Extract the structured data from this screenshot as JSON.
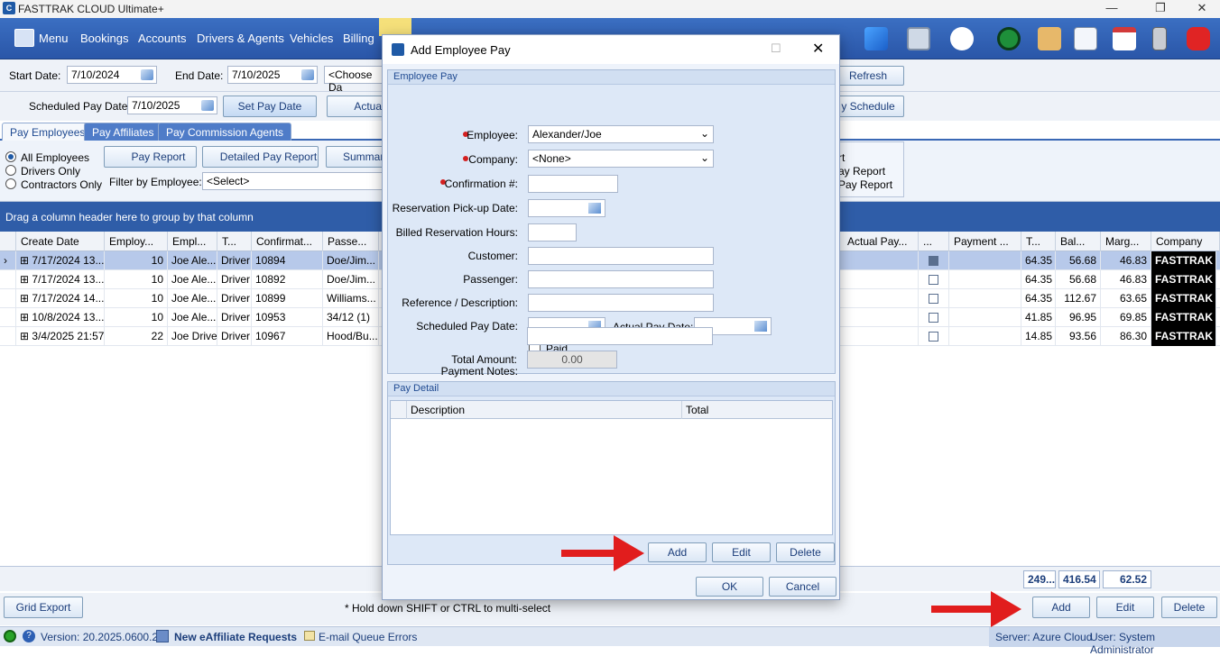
{
  "app": {
    "title": "FASTTRAK CLOUD Ultimate+"
  },
  "menu": {
    "items": [
      "Menu",
      "Bookings",
      "Accounts",
      "Drivers & Agents",
      "Vehicles",
      "Billing"
    ]
  },
  "filters": {
    "start_date_label": "Start Date:",
    "start_date": "7/10/2024",
    "end_date_label": "End Date:",
    "end_date": "7/10/2025",
    "choose_placeholder": "<Choose Da",
    "refresh": "Refresh",
    "scheduled_pay_date_label": "Scheduled Pay Date:",
    "scheduled_pay_date": "7/10/2025",
    "set_pay_date": "Set Pay Date",
    "actual_partial": "Actua",
    "pay_schedule_partial": "y Schedule"
  },
  "tabs": [
    "Pay Employees",
    "Pay Affiliates",
    "Pay Commission Agents"
  ],
  "filterpane": {
    "radios": [
      "All Employees",
      "Drivers Only",
      "Contractors Only"
    ],
    "pay_report": "Pay Report",
    "detailed_pay_report": "Detailed Pay Report",
    "summary_partial": "Summar",
    "filter_by_employee_label": "Filter by Employee:",
    "filter_by_employee_value": "<Select>",
    "right_items": [
      "rt",
      "ay Report",
      "Pay Report"
    ]
  },
  "grid": {
    "group_hint": "Drag a column header here to group by that column",
    "headers_left": [
      "Create Date",
      "Employ...",
      "Empl...",
      "T...",
      "Confirmat...",
      "Passe..."
    ],
    "headers_right": [
      "Actual Pay...",
      "...",
      "Payment ...",
      "T...",
      "Bal...",
      "Marg...",
      "Company"
    ],
    "rows": [
      {
        "create": "7/17/2024 13...",
        "emp": "10",
        "name": "Joe Ale...",
        "type": "Driver",
        "conf": "10894",
        "pass": "Doe/Jim...",
        "t": "64.35",
        "bal": "56.68",
        "marg": "46.83",
        "co": "FASTTRAK ..."
      },
      {
        "create": "7/17/2024 13...",
        "emp": "10",
        "name": "Joe Ale...",
        "type": "Driver",
        "conf": "10892",
        "pass": "Doe/Jim...",
        "t": "64.35",
        "bal": "56.68",
        "marg": "46.83",
        "co": "FASTTRAK ..."
      },
      {
        "create": "7/17/2024 14...",
        "emp": "10",
        "name": "Joe Ale...",
        "type": "Driver",
        "conf": "10899",
        "pass": "Williams...",
        "t": "64.35",
        "bal": "112.67",
        "marg": "63.65",
        "co": "FASTTRAK ..."
      },
      {
        "create": "10/8/2024 13...",
        "emp": "10",
        "name": "Joe Ale...",
        "type": "Driver",
        "conf": "10953",
        "pass": "34/12 (1)",
        "t": "41.85",
        "bal": "96.95",
        "marg": "69.85",
        "co": "FASTTRAK ..."
      },
      {
        "create": "3/4/2025 21:57",
        "emp": "22",
        "name": "Joe Driver",
        "type": "Driver",
        "conf": "10967",
        "pass": "Hood/Bu...",
        "t": "14.85",
        "bal": "93.56",
        "marg": "86.30",
        "co": "FASTTRAK ..."
      }
    ],
    "totals": {
      "t": "249...",
      "bal": "416.54",
      "marg": "62.52"
    }
  },
  "bottom": {
    "grid_export": "Grid Export",
    "hint": "* Hold down SHIFT or CTRL to multi-select",
    "add": "Add",
    "edit": "Edit",
    "delete": "Delete"
  },
  "status": {
    "version": "Version: 20.2025.0600.2",
    "eaffiliate": "New eAffiliate Requests",
    "email_errors": "E-mail Queue Errors",
    "server": "Server: Azure Cloud",
    "user": "User: System Administrator"
  },
  "modal": {
    "title": "Add Employee Pay",
    "section_employee_pay": "Employee Pay",
    "employee_label": "Employee:",
    "employee_value": "Alexander/Joe",
    "company_label": "Company:",
    "company_value": "<None>",
    "confirmation_label": "Confirmation #:",
    "pickup_label": "Reservation Pick-up Date:",
    "billed_hours_label": "Billed Reservation Hours:",
    "customer_label": "Customer:",
    "passenger_label": "Passenger:",
    "reference_label": "Reference / Description:",
    "scheduled_pay_label": "Scheduled Pay Date:",
    "actual_pay_label": "Actual Pay Date:",
    "paid_label": "Paid",
    "payment_notes_label": "Payment Notes:",
    "total_amount_label": "Total Amount:",
    "total_amount_value": "0.00",
    "section_pay_detail": "Pay Detail",
    "detail_headers": [
      "Description",
      "Total"
    ],
    "add": "Add",
    "edit": "Edit",
    "delete": "Delete",
    "ok": "OK",
    "cancel": "Cancel"
  },
  "colors": {
    "menubar": "#2a56a8",
    "accent": "#1f5aa6",
    "arrow": "#e11d1d",
    "company_cell": "#000000"
  }
}
